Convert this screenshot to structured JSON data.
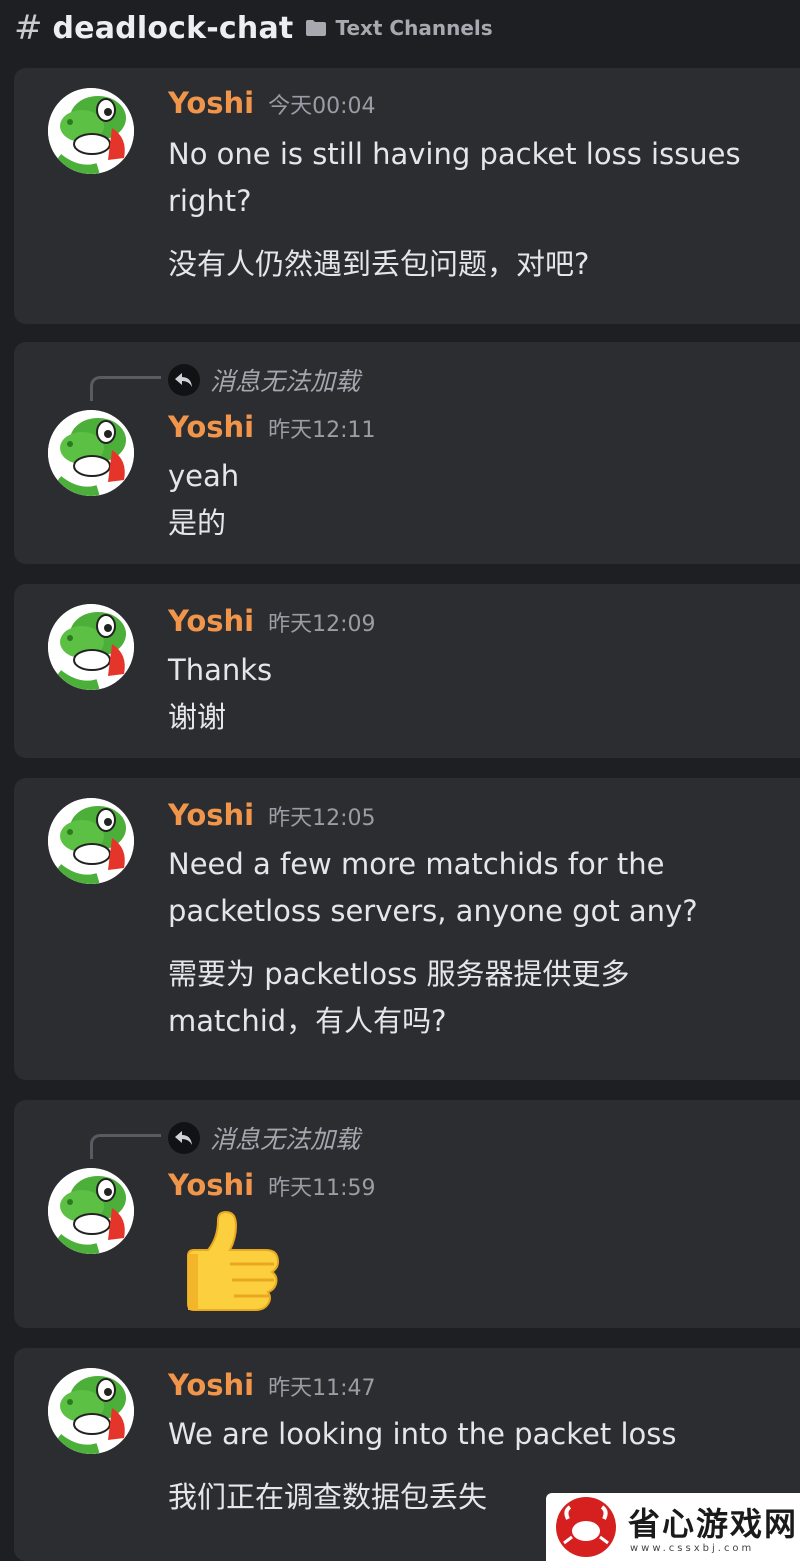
{
  "header": {
    "hash": "#",
    "channel": "deadlock-chat",
    "category": "Text Channels"
  },
  "messages": [
    {
      "author": "Yoshi",
      "timestamp": "今天00:04",
      "lines": [
        "No one is still having packet loss issues",
        "right?"
      ],
      "translation": "没有人仍然遇到丢包问题，对吧?"
    },
    {
      "reply": "消息无法加载",
      "author": "Yoshi",
      "timestamp": "昨天12:11",
      "lines": [
        "yeah"
      ],
      "translation": "是的"
    },
    {
      "author": "Yoshi",
      "timestamp": "昨天12:09",
      "lines": [
        "Thanks"
      ],
      "translation": "谢谢"
    },
    {
      "author": "Yoshi",
      "timestamp": "昨天12:05",
      "lines": [
        "Need a few more matchids for the",
        "packetloss servers, anyone got any?"
      ],
      "translation_lines": [
        "需要为 packetloss 服务器提供更多",
        "matchid，有人有吗?"
      ]
    },
    {
      "reply": "消息无法加载",
      "author": "Yoshi",
      "timestamp": "昨天11:59",
      "emoji": "thumbs-up"
    },
    {
      "author": "Yoshi",
      "timestamp": "昨天11:47",
      "lines": [
        "We are looking into the packet loss"
      ],
      "translation": "我们正在调查数据包丢失"
    }
  ],
  "watermark": {
    "text": "省心游戏网",
    "url": "www.cssxbj.com"
  },
  "colors": {
    "background": "#1e1f23",
    "message_card": "#2b2d31",
    "author": "#f0954a",
    "timestamp": "#9a9da4"
  }
}
